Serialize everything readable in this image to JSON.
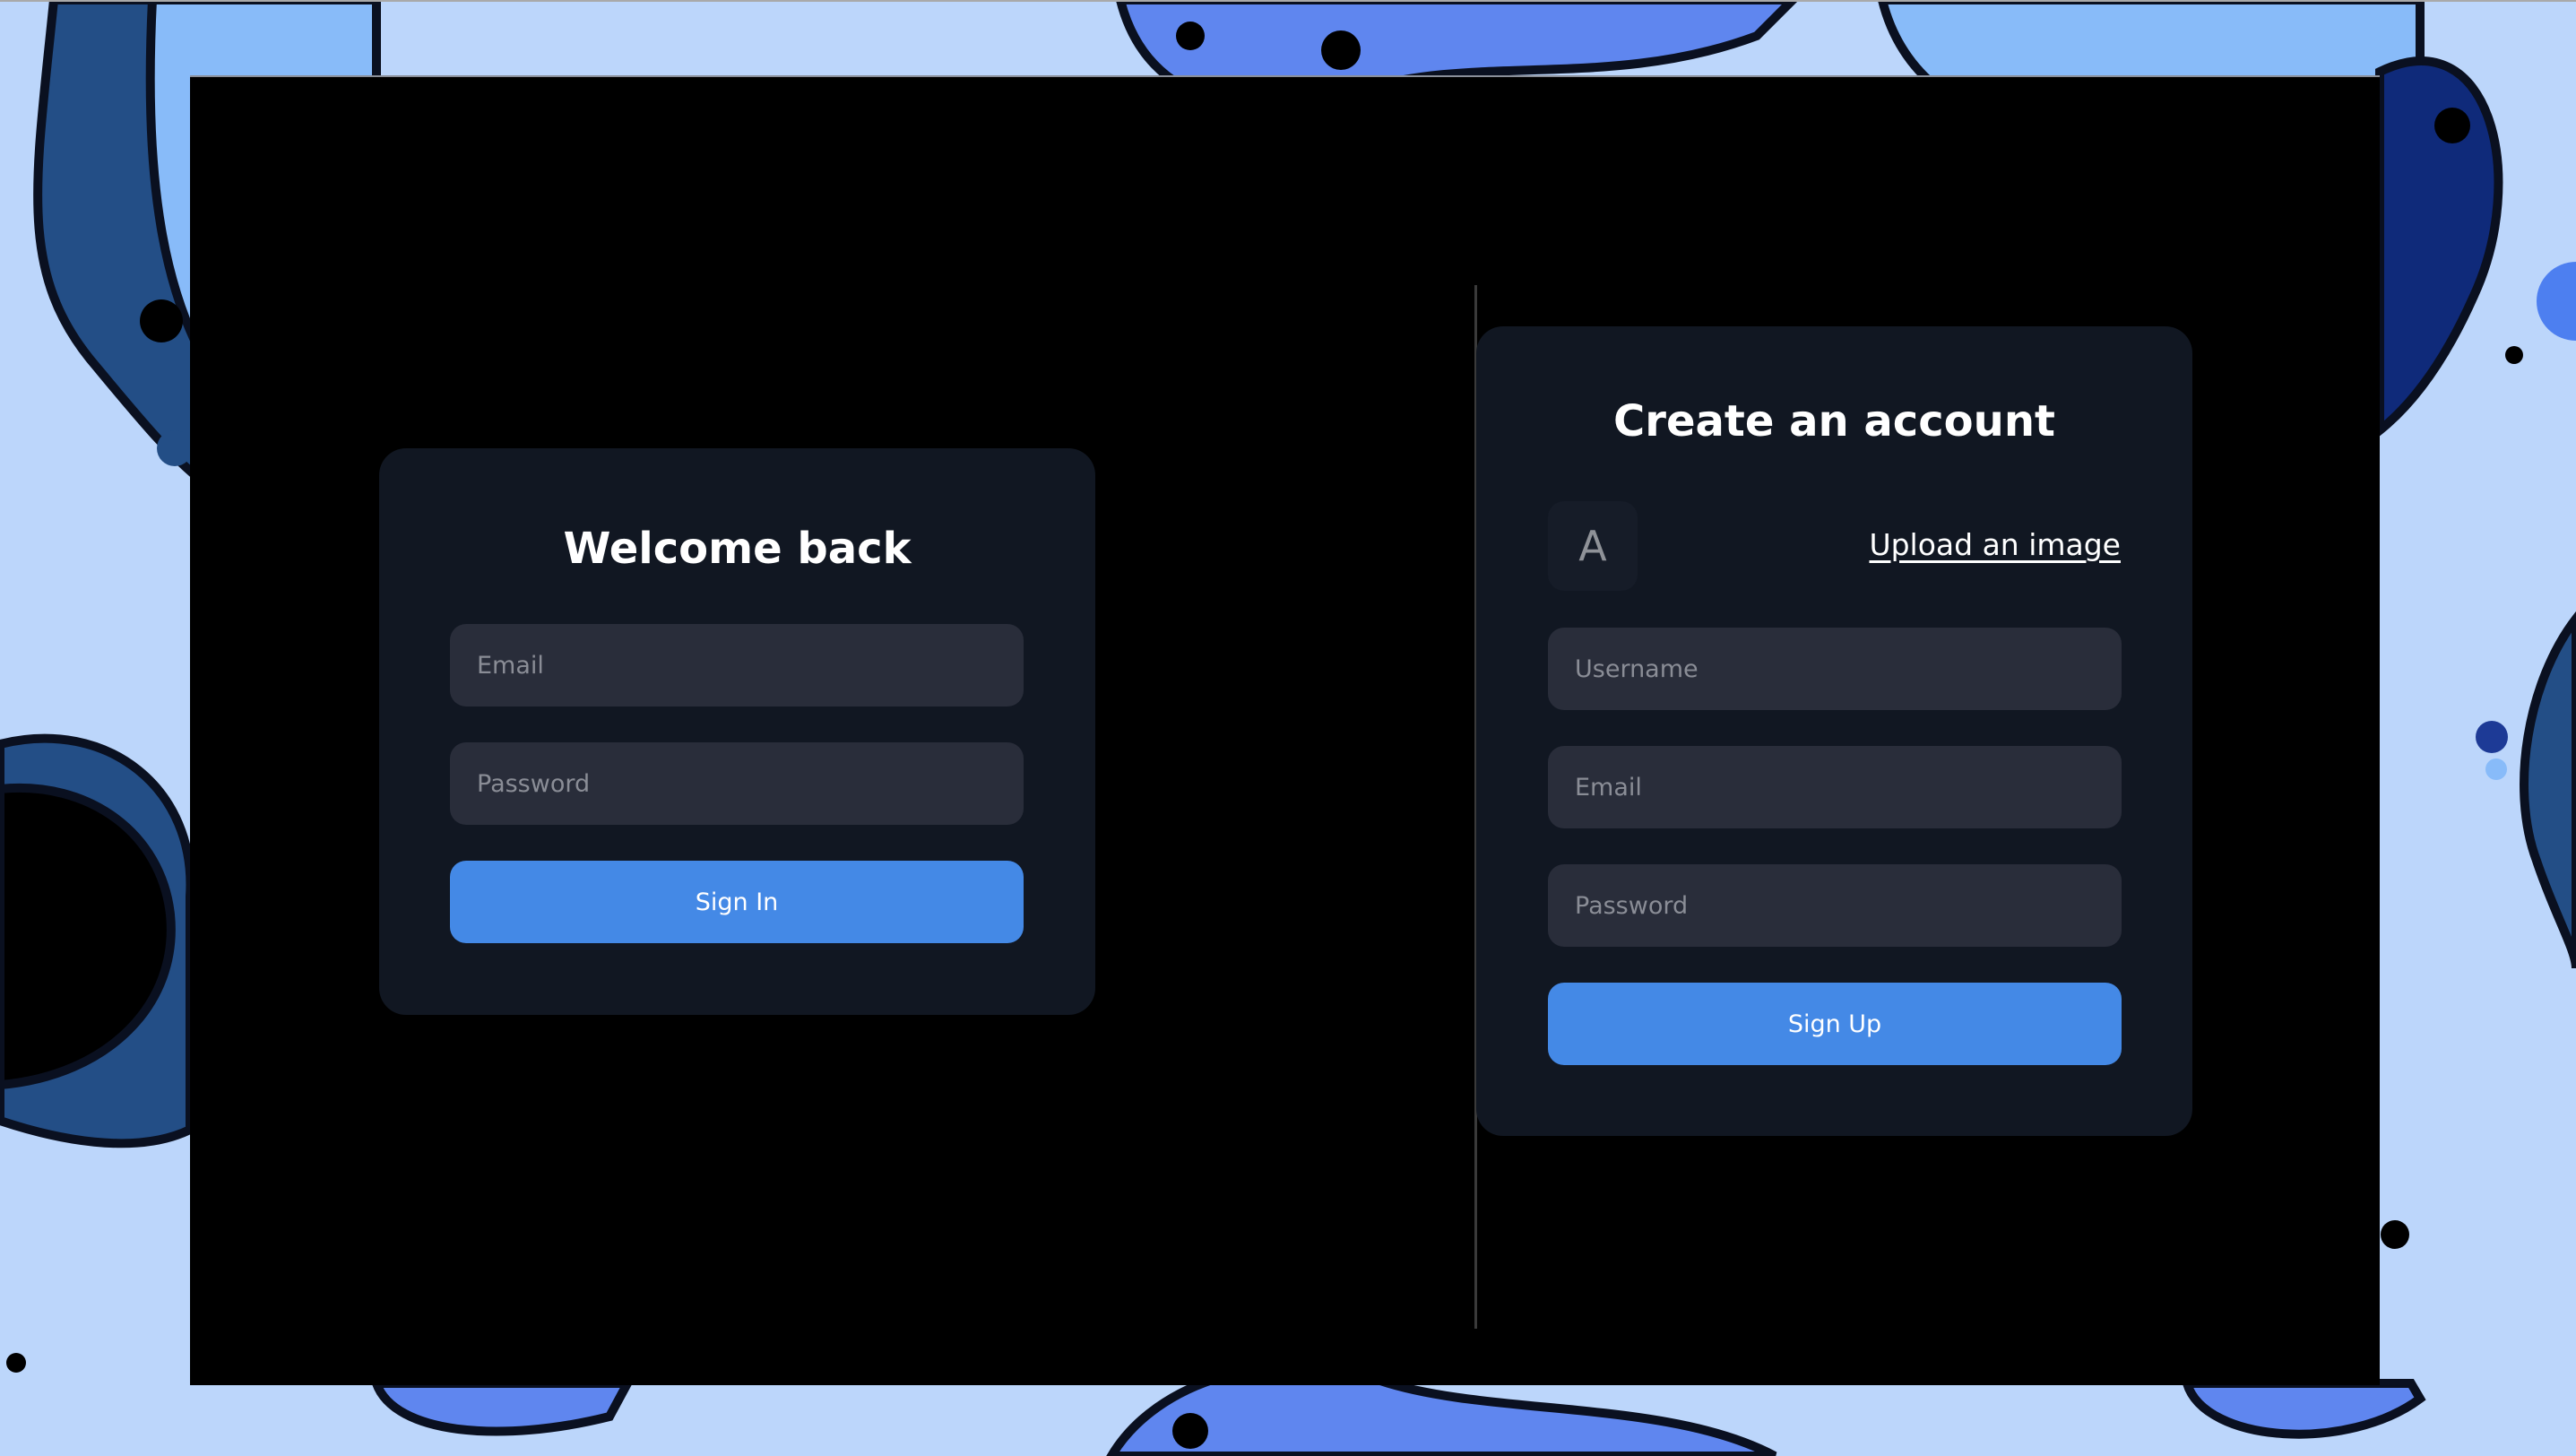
{
  "signin": {
    "title": "Welcome back",
    "email_placeholder": "Email",
    "password_placeholder": "Password",
    "submit_label": "Sign In"
  },
  "signup": {
    "title": "Create an account",
    "avatar_initial": "A",
    "upload_label": "Upload an image",
    "username_placeholder": "Username",
    "email_placeholder": "Email",
    "password_placeholder": "Password",
    "submit_label": "Sign Up"
  },
  "colors": {
    "accent": "#4489e6",
    "card": "#111722",
    "input": "#292d3a",
    "background": "#bcd6fb"
  }
}
